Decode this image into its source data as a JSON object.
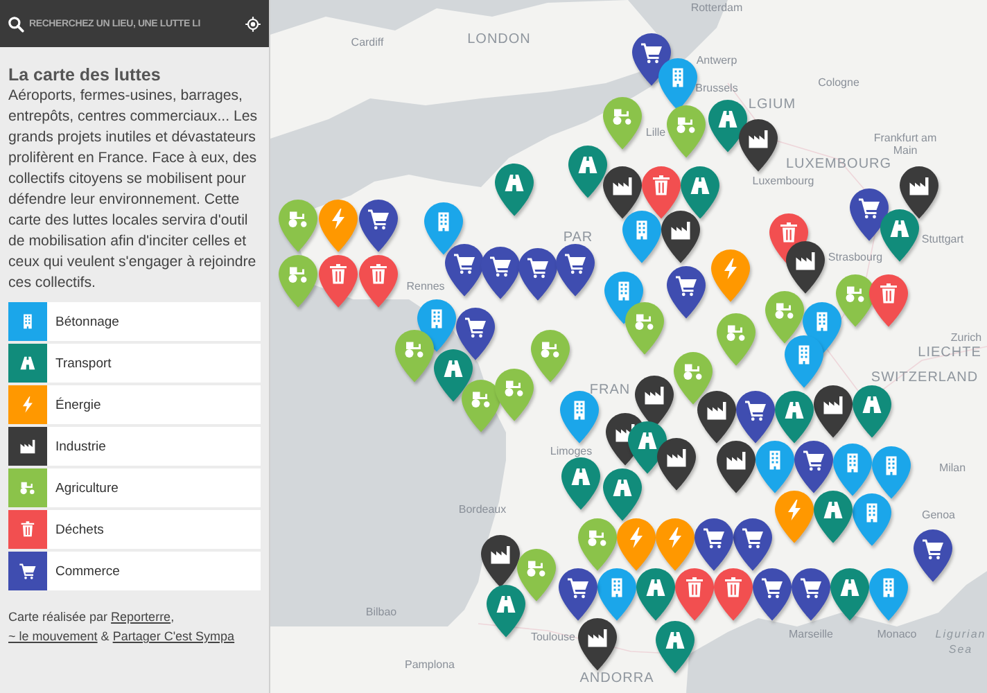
{
  "search": {
    "placeholder": "RECHERCHEZ UN LIEU, UNE LUTTE LI"
  },
  "intro": {
    "title": "La carte des luttes",
    "text": "Aéroports, fermes-usines, barrages, entrepôts, centres commerciaux... Les grands projets inutiles et dévastateurs prolifèrent en France. Face à eux, des collectifs citoyens se mobilisent pour défendre leur environnement. Cette carte des luttes locales servira d'outil de mobilisation afin d'inciter celles et ceux qui veulent s'engager à rejoindre ces collectifs."
  },
  "legend": [
    {
      "label": "Bétonnage",
      "kind": "building",
      "color": "#1ba6ea"
    },
    {
      "label": "Transport",
      "kind": "road",
      "color": "#118c7b"
    },
    {
      "label": "Énergie",
      "kind": "bolt",
      "color": "#ff9800"
    },
    {
      "label": "Industrie",
      "kind": "factory",
      "color": "#3b3b3b"
    },
    {
      "label": "Agriculture",
      "kind": "tractor",
      "color": "#8bc34a"
    },
    {
      "label": "Déchets",
      "kind": "trash",
      "color": "#f24f50"
    },
    {
      "label": "Commerce",
      "kind": "cart",
      "color": "#3f4db0"
    }
  ],
  "credits": [
    {
      "kind": "text",
      "text": "Carte réalisée par "
    },
    {
      "kind": "link",
      "text": "Reporterre"
    },
    {
      "kind": "text",
      "text": ", "
    },
    {
      "kind": "link",
      "text": "~ le mouvement"
    },
    {
      "kind": "text",
      "text": " & "
    },
    {
      "kind": "link",
      "text": "Partager C'est Sympa"
    }
  ],
  "map": {
    "labels": [
      {
        "text": "Rotterdam",
        "kind": "city"
      },
      {
        "text": "LONDON",
        "kind": "country"
      },
      {
        "text": "Cardiff",
        "kind": "city"
      },
      {
        "text": "Antwerp",
        "kind": "city"
      },
      {
        "text": "Brussels",
        "kind": "city"
      },
      {
        "text": "Lille",
        "kind": "city"
      },
      {
        "text": "LGIUM",
        "kind": "country"
      },
      {
        "text": "Cologne",
        "kind": "city"
      },
      {
        "text": "Frankfurt am",
        "kind": "city"
      },
      {
        "text": "Main",
        "kind": "city"
      },
      {
        "text": "LUXEMBOURG",
        "kind": "country"
      },
      {
        "text": "Luxembourg",
        "kind": "city"
      },
      {
        "text": "Stuttgart",
        "kind": "city"
      },
      {
        "text": "Strasbourg",
        "kind": "city"
      },
      {
        "text": "PAR",
        "kind": "country"
      },
      {
        "text": "Rennes",
        "kind": "city"
      },
      {
        "text": "Zurich",
        "kind": "city"
      },
      {
        "text": "LIECHTE",
        "kind": "country"
      },
      {
        "text": "SWITZERLAND",
        "kind": "country"
      },
      {
        "text": "FRAN",
        "kind": "country"
      },
      {
        "text": "Limoges",
        "kind": "city"
      },
      {
        "text": "Milan",
        "kind": "city"
      },
      {
        "text": "Bordeaux",
        "kind": "city"
      },
      {
        "text": "Genoa",
        "kind": "city"
      },
      {
        "text": "Bilbao",
        "kind": "city"
      },
      {
        "text": "Toulouse",
        "kind": "city"
      },
      {
        "text": "Marseille",
        "kind": "city"
      },
      {
        "text": "Monaco",
        "kind": "city"
      },
      {
        "text": "Ligurian",
        "kind": "sea"
      },
      {
        "text": "Sea",
        "kind": "sea"
      },
      {
        "text": "Pamplona",
        "kind": "city"
      },
      {
        "text": "ANDORRA",
        "kind": "country"
      }
    ],
    "markers": [
      {
        "kind": "cart"
      },
      {
        "kind": "building"
      },
      {
        "kind": "road"
      },
      {
        "kind": "tractor"
      },
      {
        "kind": "factory"
      },
      {
        "kind": "tractor"
      },
      {
        "kind": "road"
      },
      {
        "kind": "road"
      },
      {
        "kind": "factory"
      },
      {
        "kind": "building"
      },
      {
        "kind": "trash"
      },
      {
        "kind": "road"
      },
      {
        "kind": "factory"
      },
      {
        "kind": "cart"
      },
      {
        "kind": "building"
      },
      {
        "kind": "tractor"
      },
      {
        "kind": "bolt"
      },
      {
        "kind": "cart"
      },
      {
        "kind": "tractor"
      },
      {
        "kind": "trash"
      },
      {
        "kind": "trash"
      },
      {
        "kind": "cart"
      },
      {
        "kind": "cart"
      },
      {
        "kind": "cart"
      },
      {
        "kind": "cart"
      },
      {
        "kind": "building"
      },
      {
        "kind": "tractor"
      },
      {
        "kind": "bolt"
      },
      {
        "kind": "tractor"
      },
      {
        "kind": "tractor"
      },
      {
        "kind": "trash"
      },
      {
        "kind": "factory"
      },
      {
        "kind": "factory"
      },
      {
        "kind": "cart"
      },
      {
        "kind": "road"
      },
      {
        "kind": "tractor"
      },
      {
        "kind": "trash"
      },
      {
        "kind": "building"
      },
      {
        "kind": "building"
      },
      {
        "kind": "building"
      },
      {
        "kind": "cart"
      },
      {
        "kind": "tractor"
      },
      {
        "kind": "road"
      },
      {
        "kind": "tractor"
      },
      {
        "kind": "tractor"
      },
      {
        "kind": "tractor"
      },
      {
        "kind": "tractor"
      },
      {
        "kind": "building"
      },
      {
        "kind": "factory"
      },
      {
        "kind": "factory"
      },
      {
        "kind": "road"
      },
      {
        "kind": "factory"
      },
      {
        "kind": "factory"
      },
      {
        "kind": "cart"
      },
      {
        "kind": "factory"
      },
      {
        "kind": "road"
      },
      {
        "kind": "road"
      },
      {
        "kind": "factory"
      },
      {
        "kind": "building"
      },
      {
        "kind": "cart"
      },
      {
        "kind": "building"
      },
      {
        "kind": "building"
      },
      {
        "kind": "building"
      },
      {
        "kind": "bolt"
      },
      {
        "kind": "road"
      },
      {
        "kind": "road"
      },
      {
        "kind": "road"
      },
      {
        "kind": "tractor"
      },
      {
        "kind": "bolt"
      },
      {
        "kind": "bolt"
      },
      {
        "kind": "building"
      },
      {
        "kind": "cart"
      },
      {
        "kind": "road"
      },
      {
        "kind": "trash"
      },
      {
        "kind": "trash"
      },
      {
        "kind": "cart"
      },
      {
        "kind": "cart"
      },
      {
        "kind": "cart"
      },
      {
        "kind": "cart"
      },
      {
        "kind": "road"
      },
      {
        "kind": "building"
      },
      {
        "kind": "cart"
      },
      {
        "kind": "factory"
      },
      {
        "kind": "road"
      },
      {
        "kind": "tractor"
      },
      {
        "kind": "factory"
      },
      {
        "kind": "road"
      }
    ]
  }
}
